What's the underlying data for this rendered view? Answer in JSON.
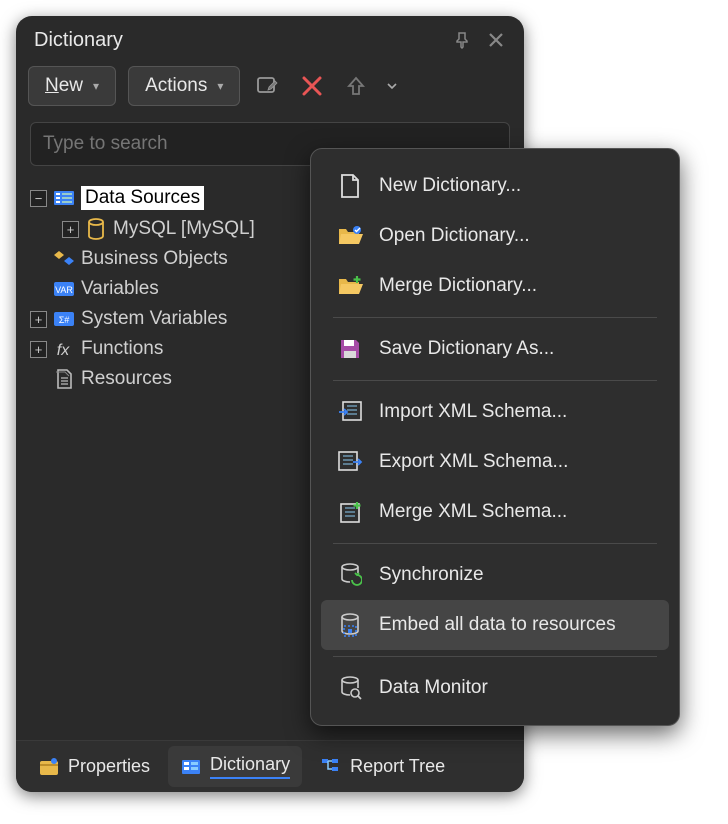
{
  "panel": {
    "title": "Dictionary"
  },
  "toolbar": {
    "new_label": "New",
    "actions_label": "Actions"
  },
  "search": {
    "placeholder": "Type to search"
  },
  "tree": {
    "data_sources": "Data Sources",
    "mysql": "MySQL [MySQL]",
    "business_objects": "Business Objects",
    "variables": "Variables",
    "system_variables": "System Variables",
    "functions": "Functions",
    "resources": "Resources"
  },
  "tabs": {
    "properties": "Properties",
    "dictionary": "Dictionary",
    "report_tree": "Report Tree"
  },
  "menu": {
    "new_dict": "New Dictionary...",
    "open_dict": "Open Dictionary...",
    "merge_dict": "Merge Dictionary...",
    "save_dict_as": "Save Dictionary As...",
    "import_xml": "Import XML Schema...",
    "export_xml": "Export XML Schema...",
    "merge_xml": "Merge XML Schema...",
    "synchronize": "Synchronize",
    "embed_all": "Embed all data to resources",
    "data_monitor": "Data Monitor"
  }
}
